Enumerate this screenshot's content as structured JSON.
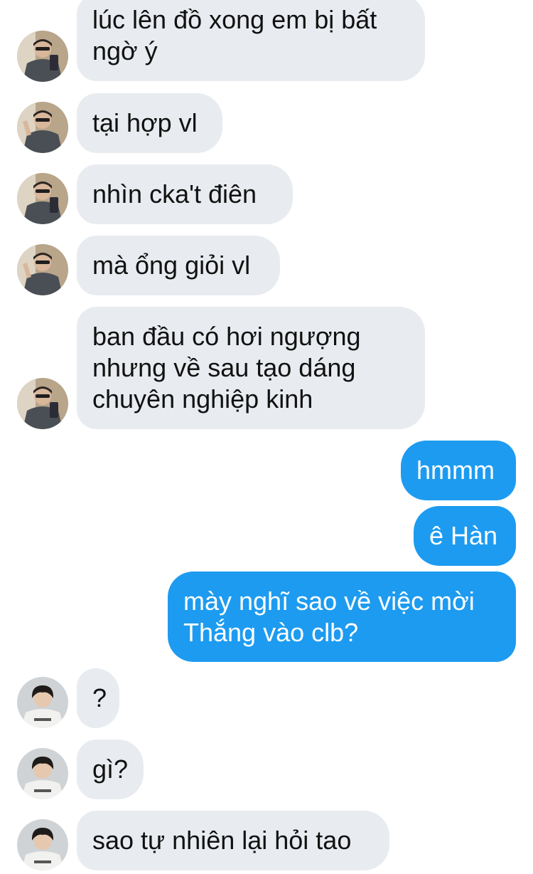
{
  "conversation": {
    "messages": [
      {
        "sender": "other",
        "text": "lúc lên đồ xong em bị bất\nngờ ý"
      },
      {
        "sender": "other",
        "text": "tại hợp vl"
      },
      {
        "sender": "other",
        "text": "nhìn cka't điên"
      },
      {
        "sender": "other",
        "text": "mà ổng giỏi vl"
      },
      {
        "sender": "other",
        "text": "ban đầu có hơi ngượng\nnhưng về sau tạo dáng\nchuyên nghiệp kinh"
      },
      {
        "sender": "me",
        "text": "hmmm"
      },
      {
        "sender": "me",
        "text": "ê Hàn"
      },
      {
        "sender": "me",
        "text": "mày nghĩ sao về việc mời\nThắng vào clb?"
      },
      {
        "sender": "other2",
        "text": "?"
      },
      {
        "sender": "other2",
        "text": "gì?"
      },
      {
        "sender": "other2",
        "text": "sao tự nhiên lại hỏi tao"
      }
    ]
  },
  "colors": {
    "incoming_bubble": "#e8ebef",
    "outgoing_bubble": "#1d9bf0",
    "incoming_text": "#111111",
    "outgoing_text": "#ffffff"
  },
  "icons": {
    "avatar_first_contact": "person-photo-avatar-grey-jacket",
    "avatar_second_contact": "person-photo-avatar-white-shirt"
  }
}
